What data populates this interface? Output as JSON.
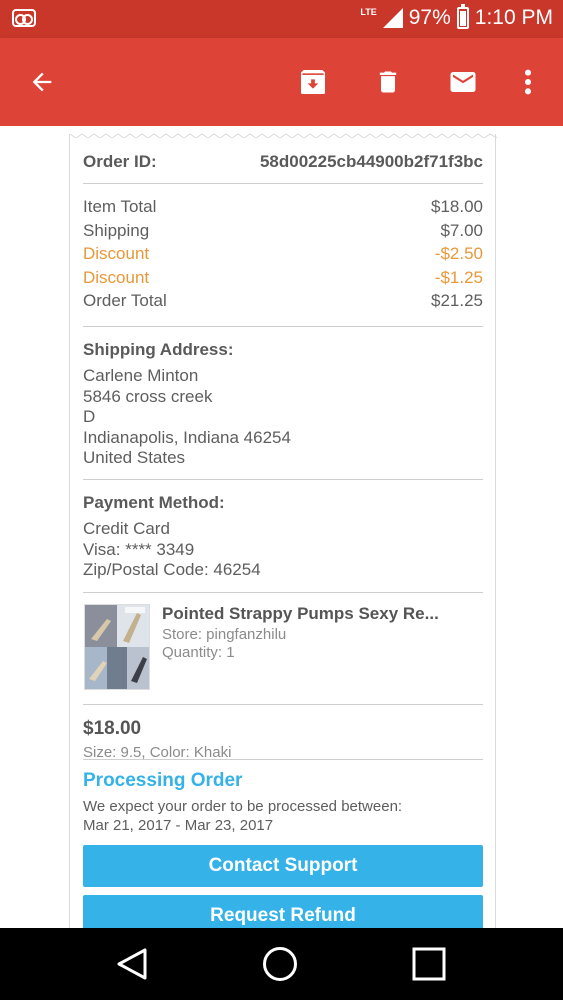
{
  "status_bar": {
    "network": "LTE",
    "battery": "97%",
    "time": "1:10 PM"
  },
  "app_bar": {
    "icons": [
      "back-arrow-icon",
      "archive-icon",
      "delete-icon",
      "mark-unread-icon",
      "more-vert-icon"
    ]
  },
  "order": {
    "id_label": "Order ID:",
    "id_value": "58d00225cb44900b2f71f3bc",
    "totals": [
      {
        "label": "Item Total",
        "value": "$18.00",
        "highlight": false
      },
      {
        "label": "Shipping",
        "value": "$7.00",
        "highlight": false
      },
      {
        "label": "Discount",
        "value": "-$2.50",
        "highlight": true
      },
      {
        "label": "Discount",
        "value": "-$1.25",
        "highlight": true
      },
      {
        "label": "Order Total",
        "value": "$21.25",
        "highlight": false
      }
    ],
    "shipping": {
      "label": "Shipping Address:",
      "lines": [
        "Carlene Minton",
        "5846 cross creek",
        "D",
        "Indianapolis, Indiana 46254",
        "United States"
      ]
    },
    "payment": {
      "label": "Payment Method:",
      "lines": [
        "Credit Card",
        "Visa: **** 3349",
        "Zip/Postal Code: 46254"
      ]
    },
    "product": {
      "title": "Pointed Strappy Pumps Sexy Re...",
      "store": "Store: pingfanzhilu",
      "quantity": "Quantity: 1",
      "price": "$18.00",
      "variant": "Size: 9.5, Color: Khaki"
    },
    "processing": {
      "title": "Processing Order",
      "text_line1": "We expect your order to be processed between:",
      "text_line2": "Mar 21, 2017 - Mar 23, 2017"
    },
    "buttons": {
      "contact": "Contact Support",
      "refund": "Request Refund"
    }
  },
  "colors": {
    "status_bar": "#c9372b",
    "app_bar": "#dd4437",
    "discount": "#e8983a",
    "accent_blue": "#35b2e7"
  }
}
